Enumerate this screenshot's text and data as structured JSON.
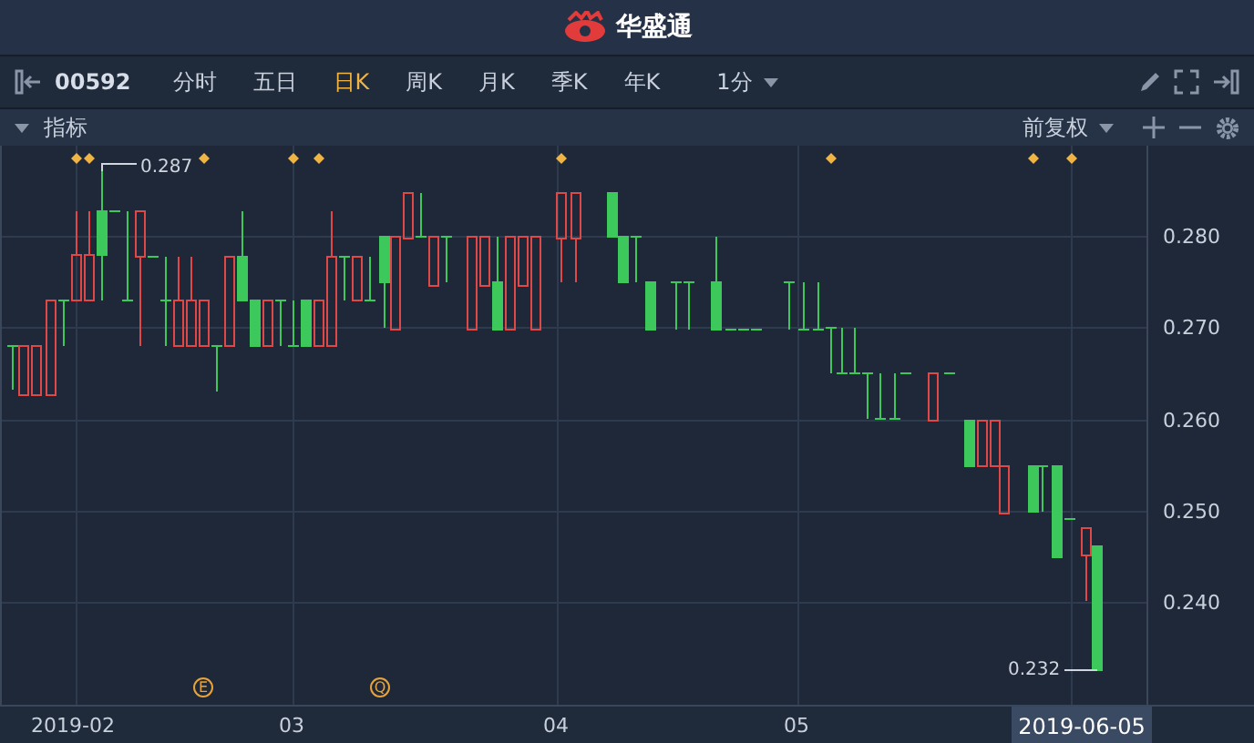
{
  "header": {
    "title": "华盛通"
  },
  "toolbar": {
    "code": "00592",
    "tabs": [
      {
        "label": "分时",
        "selected": false
      },
      {
        "label": "五日",
        "selected": false
      },
      {
        "label": "日K",
        "selected": true
      },
      {
        "label": "周K",
        "selected": false
      },
      {
        "label": "月K",
        "selected": false
      },
      {
        "label": "季K",
        "selected": false
      },
      {
        "label": "年K",
        "selected": false
      }
    ],
    "interval": "1分"
  },
  "subbar": {
    "indicator": "指标",
    "adjust": "前复权"
  },
  "chart": {
    "y_labels": [
      "0.280",
      "0.270",
      "0.260",
      "0.250",
      "0.240"
    ],
    "max_label": "0.287",
    "min_label": "0.232",
    "event_markers": [
      "E",
      "Q"
    ],
    "x_labels": [
      "2019-02",
      "03",
      "04",
      "05"
    ],
    "current_date": "2019-06-05"
  }
}
